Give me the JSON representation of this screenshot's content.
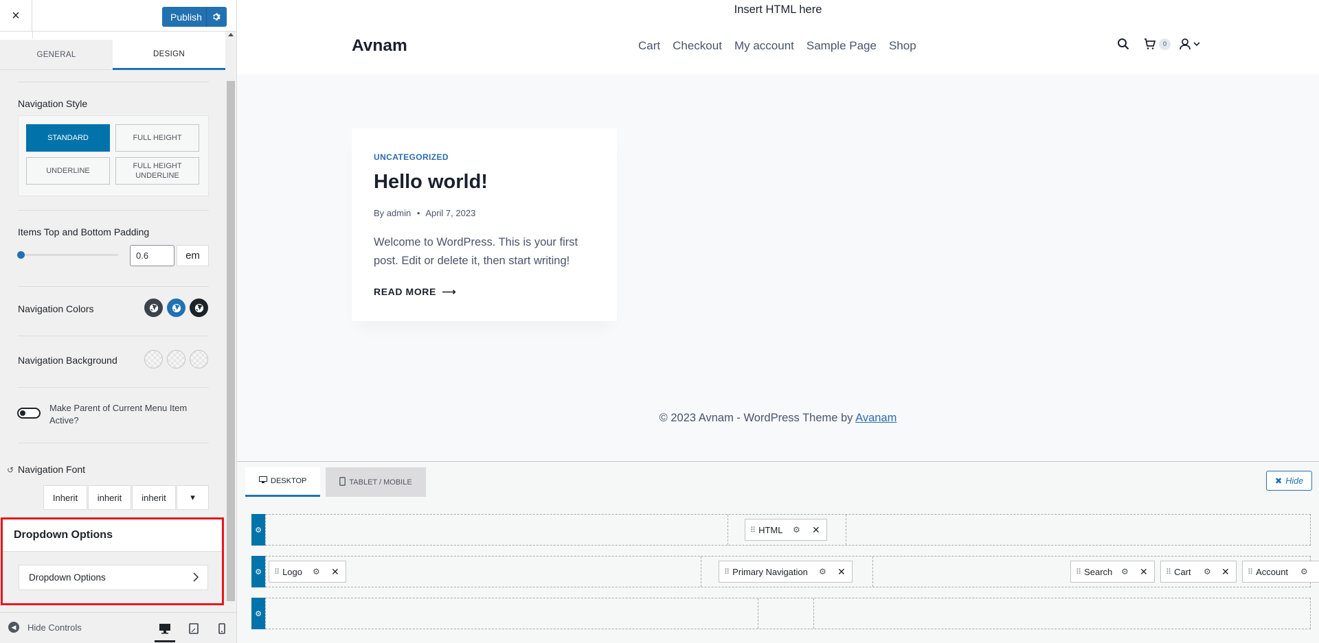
{
  "sidebar": {
    "close": "×",
    "publish": "Publish",
    "tabs": [
      "General",
      "Design"
    ],
    "navigation_style": {
      "label": "Navigation Style",
      "options": [
        "Standard",
        "Full Height",
        "Underline",
        "Full Height Underline"
      ],
      "selected": "Standard"
    },
    "padding": {
      "label": "Items Top and Bottom Padding",
      "value": "0.6",
      "unit": "em",
      "slider_fraction": 0.0
    },
    "nav_colors_label": "Navigation Colors",
    "nav_colors": [
      "#3c434a",
      "#2271b1",
      "#1d2327"
    ],
    "nav_background_label": "Navigation Background",
    "toggle": {
      "label": "Make Parent of Current Menu Item Active?",
      "on": false
    },
    "font": {
      "label": "Navigation Font",
      "family": "Inherit",
      "weight": "inherit",
      "style": "inherit",
      "more": "▾"
    },
    "dropdown": {
      "section_title": "Dropdown Options",
      "item_label": "Dropdown Options"
    },
    "hide_controls": "Hide Controls"
  },
  "preview": {
    "html_text": "Insert HTML here",
    "site_title": "Avnam",
    "menu": [
      "Cart",
      "Checkout",
      "My account",
      "Sample Page",
      "Shop"
    ],
    "cart_count": "0",
    "post": {
      "category": "Uncategorized",
      "title": "Hello world!",
      "by": "By",
      "author": "admin",
      "sep": "•",
      "date": "April 7, 2023",
      "excerpt": "Welcome to WordPress. This is your first post. Edit or delete it, then start writing!",
      "read_more": "READ MORE"
    },
    "footer": {
      "text": "© 2023 Avnam - WordPress Theme by",
      "link": "Avanam"
    }
  },
  "builder": {
    "tabs": [
      "Desktop",
      "Tablet / Mobile"
    ],
    "hide": "Hide",
    "row1": {
      "center": "HTML"
    },
    "row2": {
      "left": "Logo",
      "center": "Primary Navigation",
      "right": [
        "Search",
        "Cart",
        "Account"
      ]
    }
  },
  "colors": {
    "accent": "#2271b1",
    "highlight_box": "#e8171d"
  }
}
